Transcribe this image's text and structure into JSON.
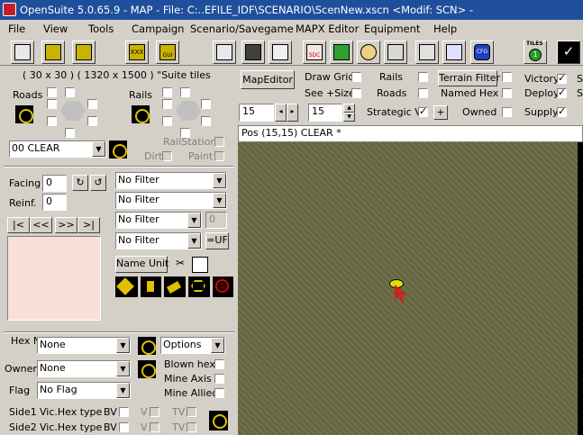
{
  "title": "OpenSuite  5.0.65.9 - MAP - File: C:..EFILE_IDF\\SCENARIO\\ScenNew.xscn <Modif: SCN>  -",
  "menu": [
    "File",
    "View",
    "Tools",
    "Campaign",
    "Scenario/Savegame",
    "MAPX Editor",
    "Equipment",
    "Help"
  ],
  "toolbar": {
    "icons": [
      "unit-icon",
      "xxx-icon",
      "map-icon",
      "gui-icon",
      "edit-icon",
      "save-icon",
      "export-icon",
      "sdc-icon",
      "page-icon",
      "face-icon",
      "print-icon",
      "tools-icon",
      "arrows-icon",
      "cfg-icon",
      "tiles-icon",
      "check-icon"
    ],
    "gui_label": "GUI",
    "xxx_label": "XXX",
    "sdc_label": "SDC",
    "cfg_label": "CFG",
    "tiles_label": "TILES",
    "tiles_number": "1"
  },
  "left": {
    "size_info": "( 30 x 30 )  ( 1320 x 1500 ) \"Suite tiles",
    "roads_label": "Roads",
    "rails_label": "Rails",
    "terrain_select": "00 CLEAR",
    "railstation_label": "RailStation",
    "dirt_label": "Dirt",
    "paint_label": "Paint",
    "facing_label": "Facing",
    "facing_value": "0",
    "reinf_label": "Reinf.",
    "reinf_value": "0",
    "nav_buttons": [
      "|<",
      "<<",
      ">>",
      ">|"
    ],
    "filters": [
      "No Filter",
      "No Filter",
      "No Filter",
      "No Filter"
    ],
    "filter_small_value": "0",
    "uf_button": "=UF",
    "name_unit_button": "Name Unit",
    "hex_name_label": "Hex Name",
    "hex_name_value": "None",
    "owner_label": "Owner",
    "owner_value": "None",
    "flag_label": "Flag",
    "flag_value": "No Flag",
    "options_label": "Options",
    "blown_hex_label": "Blown hex",
    "mine_axis_label": "Mine Axis",
    "mine_allied_label": "Mine Allied",
    "side1_label": "Side1",
    "side2_label": "Side2",
    "vic_hex_label": "Vic.Hex type",
    "bv_label": "BV",
    "v_label": "V",
    "tv_label": "TV"
  },
  "top": {
    "mapeditor_button": "MapEditor",
    "draw_grid": "Draw Grid",
    "see_size": "See +Size",
    "rails": "Rails",
    "roads": "Roads",
    "terrain_filter_button": "Terrain Filter",
    "named_hex": "Named Hex",
    "owned": "Owned",
    "victory": "Victory",
    "deploy": "Deploy",
    "supply": "Supply",
    "cut_s1": "S",
    "cut_s2": "S",
    "spin1_value": "15",
    "spin2_value": "15",
    "strategic": "Strategic V.",
    "plus": "+",
    "pos_bar": "Pos (15,15)  CLEAR  *"
  }
}
